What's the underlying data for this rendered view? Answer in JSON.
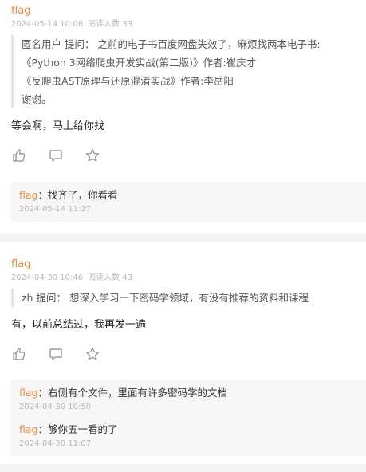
{
  "posts": [
    {
      "author": "flag",
      "date": "2024-05-14 10:06",
      "reads": "阅读人数 33",
      "question": {
        "user": "匿名用户",
        "prefix": "提问：",
        "text": "之前的电子书百度网盘失效了，麻烦找两本电子书:",
        "books": [
          {
            "title": "《Python 3网络爬虫开发实战(第二版)》",
            "info": "作者:崔庆才"
          },
          {
            "title": "《反爬虫AST原理与还原混淆实战》",
            "info": "作者:李岳阳"
          }
        ],
        "thanks": "谢谢。"
      },
      "reply": "等会啊，马上给你找",
      "actions": [
        {
          "icon": "thumbs-up-icon"
        },
        {
          "icon": "comment-icon"
        },
        {
          "icon": "star-icon"
        }
      ],
      "comments": [
        {
          "author": "flag",
          "sep": "：",
          "text": "找齐了，你看看",
          "time": "2024-05-14 11:37"
        }
      ]
    },
    {
      "author": "flag",
      "date": "2024-04-30 10:46",
      "reads": "阅读人数 43",
      "question": {
        "user": "zh",
        "prefix": "提问：",
        "text": "想深入学习一下密码学领域，有没有推荐的资料和课程"
      },
      "reply": "有，以前总结过，我再发一遍",
      "actions": [
        {
          "icon": "thumbs-up-icon"
        },
        {
          "icon": "comment-icon"
        },
        {
          "icon": "star-icon"
        }
      ],
      "comments": [
        {
          "author": "flag",
          "sep": "：",
          "text": "右侧有个文件，里面有许多密码学的文档",
          "time": "2024-04-30 10:50"
        },
        {
          "author": "flag",
          "sep": "：",
          "text": "够你五一看的了",
          "time": "2024-04-30 11:07"
        }
      ]
    }
  ],
  "colors": {
    "accent": "#f2883a",
    "muted": "#b8b8b8",
    "background": "#f4f4f4"
  }
}
